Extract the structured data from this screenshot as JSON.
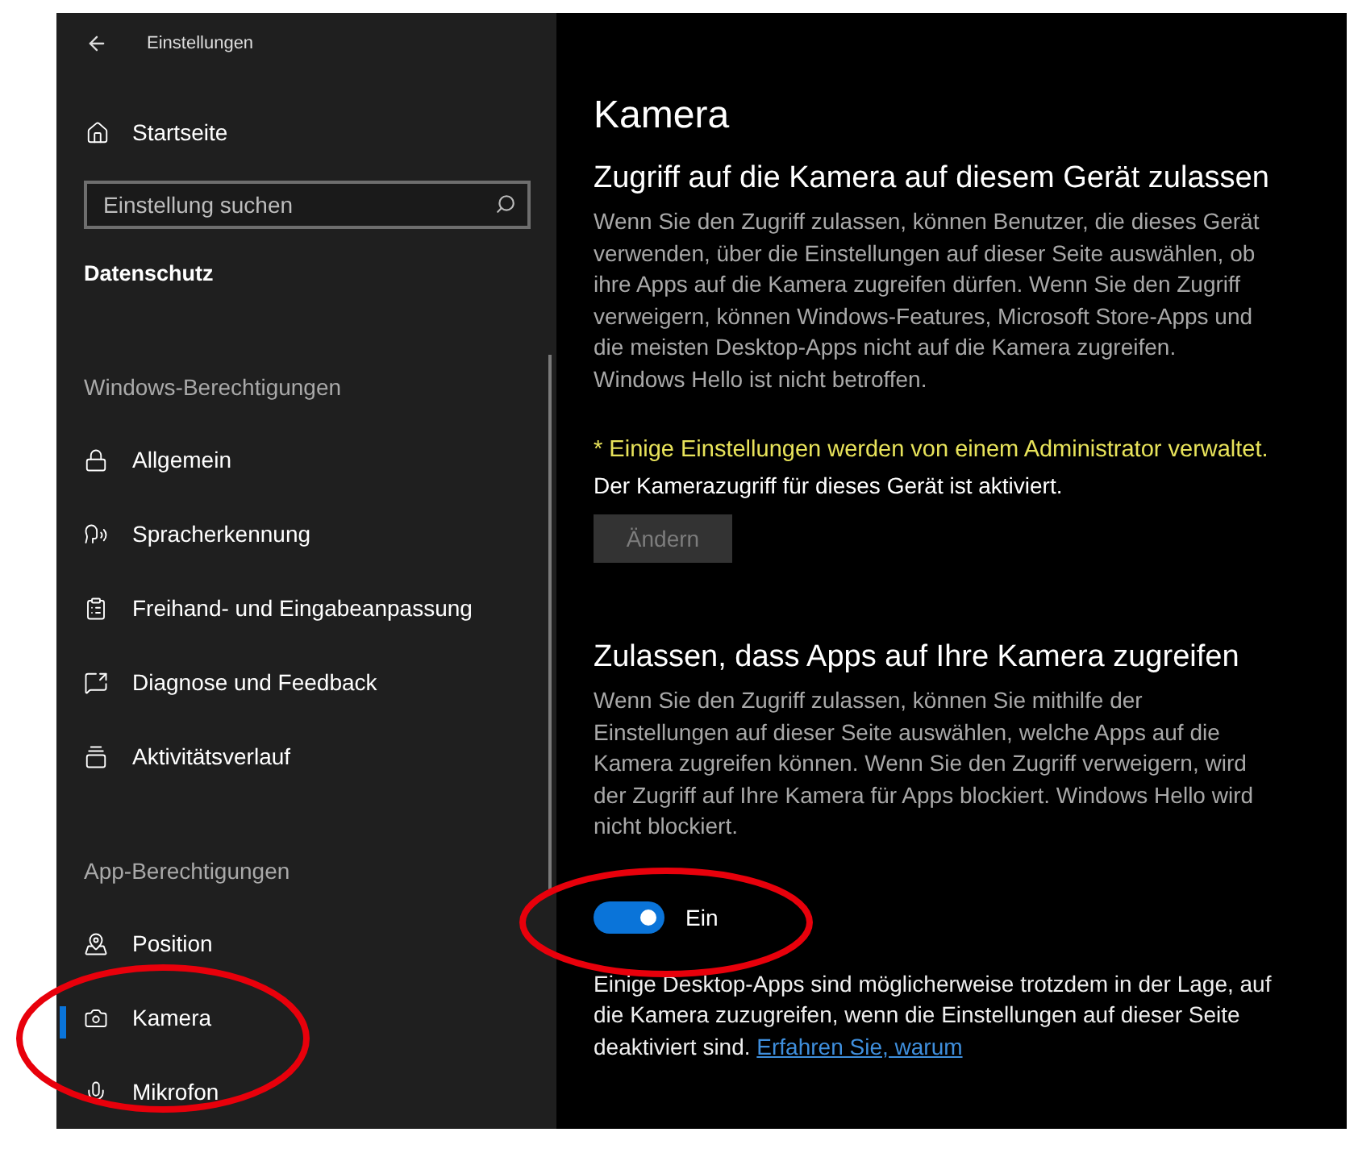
{
  "window": {
    "title": "Einstellungen"
  },
  "sidebar": {
    "home": "Startseite",
    "search": {
      "placeholder": "Einstellung suchen"
    },
    "category": "Datenschutz",
    "groups": [
      {
        "heading": "Windows-Berechtigungen",
        "items": [
          {
            "label": "Allgemein",
            "selected": false
          },
          {
            "label": "Spracherkennung",
            "selected": false
          },
          {
            "label": "Freihand- und Eingabeanpassung",
            "selected": false
          },
          {
            "label": "Diagnose und Feedback",
            "selected": false
          },
          {
            "label": "Aktivitätsverlauf",
            "selected": false
          }
        ]
      },
      {
        "heading": "App-Berechtigungen",
        "items": [
          {
            "label": "Position",
            "selected": false
          },
          {
            "label": "Kamera",
            "selected": true
          },
          {
            "label": "Mikrofon",
            "selected": false
          }
        ]
      }
    ]
  },
  "page": {
    "title": "Kamera",
    "device_section": {
      "heading": "Zugriff auf die Kamera auf diesem Gerät zulassen",
      "description": "Wenn Sie den Zugriff zulassen, können Benutzer, die dieses Gerät verwenden, über die Einstellungen auf dieser Seite auswählen, ob ihre Apps auf die Kamera zugreifen dürfen. Wenn Sie den Zugriff verweigern, können Windows-Features, Microsoft Store-Apps und die meisten Desktop-Apps nicht auf die Kamera zugreifen. Windows Hello ist nicht betroffen.",
      "admin_note": "* Einige Einstellungen werden von einem Administrator verwaltet.",
      "status": "Der Kamerazugriff für dieses Gerät ist aktiviert.",
      "button": {
        "label": "Ändern",
        "disabled": true
      }
    },
    "apps_section": {
      "heading": "Zulassen, dass Apps auf Ihre Kamera zugreifen",
      "description": "Wenn Sie den Zugriff zulassen, können Sie mithilfe der Einstellungen auf dieser Seite auswählen, welche Apps auf die Kamera zugreifen können. Wenn Sie den Zugriff verweigern, wird der Zugriff auf Ihre Kamera für Apps blockiert. Windows Hello wird nicht blockiert.",
      "toggle": {
        "on": true,
        "label": "Ein"
      },
      "note": "Einige Desktop-Apps sind möglicherweise trotzdem in der Lage, auf die Kamera zuzugreifen, wenn die Einstellungen auf dieser Seite deaktiviert sind.",
      "link": "Erfahren Sie, warum"
    }
  }
}
